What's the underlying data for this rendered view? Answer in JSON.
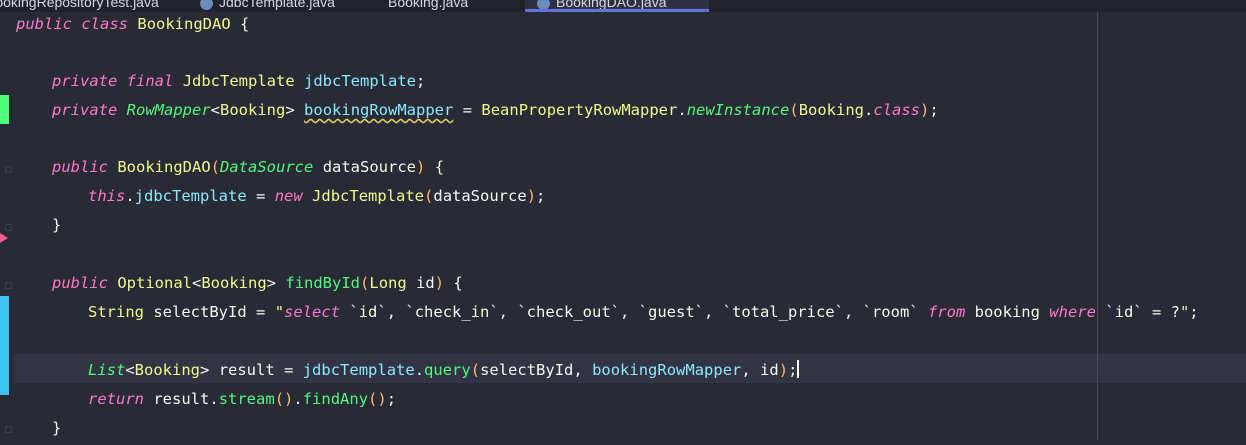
{
  "tabs": [
    {
      "label": "BookingRepositoryTest.java"
    },
    {
      "label": "JdbcTemplate.java"
    },
    {
      "label": "Booking.java"
    },
    {
      "label": "BookingDAO.java",
      "active": true
    }
  ],
  "colors": {
    "background": "#282a36",
    "keyword": "#ff79c6",
    "class": "#f1fa8c",
    "field": "#8be9fd",
    "method": "#50fa7b",
    "gutter_added": "#50fa7b",
    "gutter_modified": "#3bc4f0",
    "breakpoint": "#ff5c8a"
  },
  "code": {
    "class_decl": {
      "kw1": "public",
      "kw2": "class",
      "name": "BookingDAO",
      "brace": "{"
    },
    "field1": {
      "kw1": "private",
      "kw2": "final",
      "type": "JdbcTemplate",
      "name": "jdbcTemplate",
      "end": ";"
    },
    "field2": {
      "kw": "private",
      "type": "RowMapper",
      "generic": "Booking",
      "name": "bookingRowMapper",
      "eq": "=",
      "factory": "BeanPropertyRowMapper",
      "method": "newInstance",
      "arg": "Booking",
      "argkw": "class",
      "end": ";"
    },
    "ctor": {
      "kw": "public",
      "name": "BookingDAO",
      "ptype": "DataSource",
      "pname": "dataSource",
      "brace": "{"
    },
    "ctor_body": {
      "this": "this",
      "field": "jdbcTemplate",
      "eq": "=",
      "new": "new",
      "type": "JdbcTemplate",
      "arg": "dataSource",
      "end": ";"
    },
    "close1": "}",
    "method": {
      "kw": "public",
      "rtype": "Optional",
      "generic": "Booking",
      "name": "findById",
      "ptype": "Long",
      "pname": "id",
      "brace": "{"
    },
    "sql_line": {
      "type": "String",
      "var": "selectById",
      "eq": "=",
      "q1": "\"",
      "s_select": "select",
      "s_cols": " `id`, `check_in`, `check_out`, `guest`, `total_price`, `room` ",
      "s_from": "from",
      "s_mid": " booking ",
      "s_where": "where",
      "s_tail": " `id` = ?",
      "q2": "\"",
      "end": ";"
    },
    "query_line": {
      "type": "List",
      "generic": "Booking",
      "var": "result",
      "eq": "=",
      "obj": "jdbcTemplate",
      "method": "query",
      "a1": "selectById",
      "a2": "bookingRowMapper",
      "a3": "id",
      "end": ";"
    },
    "return_line": {
      "kw": "return",
      "var": "result",
      "m1": "stream",
      "m2": "findAny",
      "end": ";"
    },
    "close2": "}"
  }
}
